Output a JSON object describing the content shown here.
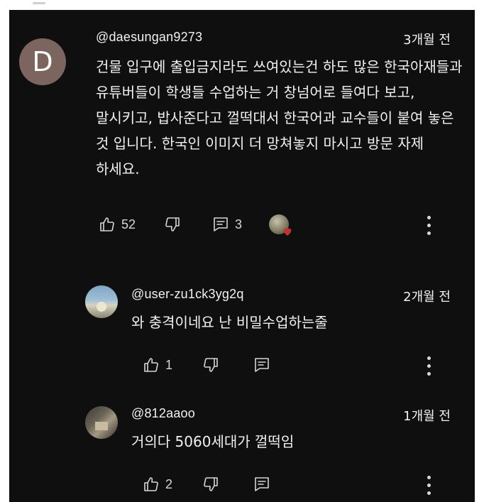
{
  "comments": [
    {
      "avatar_letter": "D",
      "handle": "@daesungan9273",
      "time": "3개월 전",
      "text": "건물 입구에 출입금지라도 쓰여있는건 하도 많은 한국아재들과 유튜버들이 학생들 수업하는 거 창넘어로 들여다 보고, 말시키고, 밥사준다고 껄떡대서 한국어과 교수들이 붙여 놓은 것 입니다. 한국인 이미지 더 망쳐놓지 마시고 방문 자제 하세요.",
      "likes": "52",
      "replies": "3"
    },
    {
      "handle": "@user-zu1ck3yg2q",
      "time": "2개월 전",
      "text": "와 충격이네요 난 비밀수업하는줄",
      "likes": "1"
    },
    {
      "handle": "@812aaoo",
      "time": "1개월 전",
      "text": "거의다 5060세대가 껄떡임",
      "likes": "2"
    }
  ],
  "colors": {
    "background": "#0f0f0f",
    "text": "#f1f1f1",
    "icon": "#d6d6d6",
    "heart": "#c4302b"
  },
  "icons": [
    "thumbs-up-icon",
    "thumbs-down-icon",
    "reply-icon",
    "more-vert-icon",
    "heart-icon"
  ]
}
